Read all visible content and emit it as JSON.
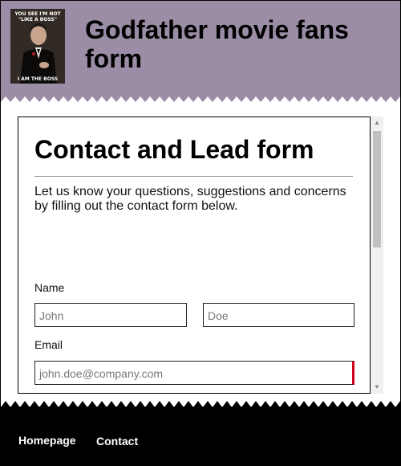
{
  "header": {
    "logo": {
      "top_text": "YOU SEE I'M NOT \"LIKE A BOSS\"",
      "bottom_text": "I AM THE BOSS"
    },
    "title": "Godfather movie fans form"
  },
  "form": {
    "title": "Contact and Lead form",
    "intro": "Let us know your questions, suggestions and concerns by filling out the contact form below.",
    "name_label": "Name",
    "first_name_placeholder": "John",
    "last_name_placeholder": "Doe",
    "email_label": "Email",
    "email_placeholder": "john.doe@company.com"
  },
  "footer": {
    "nav": [
      {
        "label": "Homepage"
      },
      {
        "label": "Contact"
      }
    ]
  },
  "colors": {
    "header_bg": "#9a8da5",
    "footer_bg": "#000000",
    "invalid_marker": "#d0021b"
  }
}
